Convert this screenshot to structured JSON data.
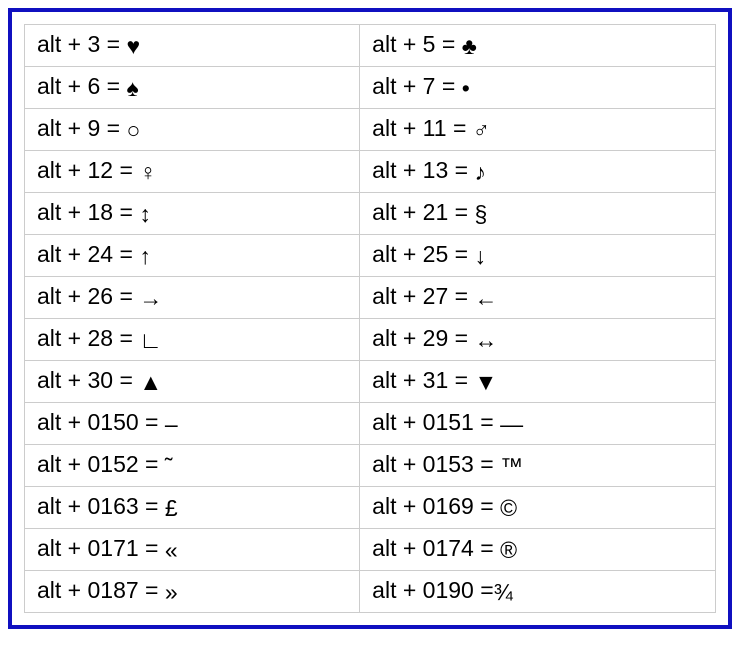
{
  "rows": [
    {
      "left": {
        "code": "alt + 3 = ",
        "symbol": "♥"
      },
      "right": {
        "code": "alt + 5 = ",
        "symbol": "♣"
      }
    },
    {
      "left": {
        "code": "alt + 6 = ",
        "symbol": "♠"
      },
      "right": {
        "code": "alt + 7 = ",
        "symbol": "•"
      }
    },
    {
      "left": {
        "code": "alt + 9 = ",
        "symbol": "○"
      },
      "right": {
        "code": "alt + 11 = ",
        "symbol": "♂"
      }
    },
    {
      "left": {
        "code": "alt + 12 = ",
        "symbol": "♀"
      },
      "right": {
        "code": "alt + 13 = ",
        "symbol": "♪"
      }
    },
    {
      "left": {
        "code": "alt + 18 = ",
        "symbol": "↕"
      },
      "right": {
        "code": "alt + 21 = ",
        "symbol": "§"
      }
    },
    {
      "left": {
        "code": "alt + 24 = ",
        "symbol": "↑"
      },
      "right": {
        "code": "alt + 25 = ",
        "symbol": "↓"
      }
    },
    {
      "left": {
        "code": "alt + 26 = ",
        "symbol": "→"
      },
      "right": {
        "code": "alt + 27 = ",
        "symbol": "←"
      }
    },
    {
      "left": {
        "code": "alt + 28 = ",
        "symbol": "∟"
      },
      "right": {
        "code": "alt + 29 = ",
        "symbol": "↔"
      }
    },
    {
      "left": {
        "code": "alt + 30 = ",
        "symbol": "▲"
      },
      "right": {
        "code": "alt + 31 = ",
        "symbol": "▼"
      }
    },
    {
      "left": {
        "code": "alt + 0150 = ",
        "symbol": "–"
      },
      "right": {
        "code": "alt + 0151 = ",
        "symbol": "—"
      }
    },
    {
      "left": {
        "code": "alt + 0152 = ",
        "symbol": "˜"
      },
      "right": {
        "code": "alt + 0153 = ",
        "symbol": "™"
      }
    },
    {
      "left": {
        "code": "alt + 0163 = ",
        "symbol": "£"
      },
      "right": {
        "code": "alt + 0169 = ",
        "symbol": "©"
      }
    },
    {
      "left": {
        "code": "alt + 0171 = ",
        "symbol": "«"
      },
      "right": {
        "code": "alt + 0174 = ",
        "symbol": "®"
      }
    },
    {
      "left": {
        "code": "alt + 0187 = ",
        "symbol": "»"
      },
      "right": {
        "code": "alt + 0190 =",
        "symbol": "¾"
      }
    }
  ]
}
